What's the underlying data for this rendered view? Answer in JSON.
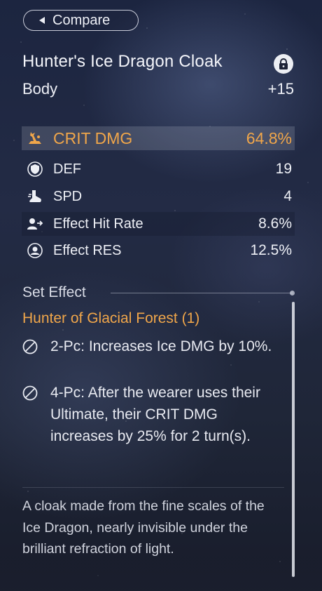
{
  "compare_button": {
    "label": "Compare",
    "icon": "back-triangle-icon"
  },
  "relic": {
    "name": "Hunter's Ice Dragon Cloak",
    "slot": "Body",
    "level": "+15",
    "lock_icon": "lock-icon"
  },
  "main_stat": {
    "name": "CRIT DMG",
    "value": "64.8%",
    "icon": "crit-dmg-icon",
    "color": "#f0a64a"
  },
  "sub_stats": [
    {
      "name": "DEF",
      "value": "19",
      "icon": "shield-icon"
    },
    {
      "name": "SPD",
      "value": "4",
      "icon": "boot-icon"
    },
    {
      "name": "Effect Hit Rate",
      "value": "8.6%",
      "icon": "effect-hit-rate-icon"
    },
    {
      "name": "Effect RES",
      "value": "12.5%",
      "icon": "effect-res-icon"
    }
  ],
  "set_effect": {
    "header": "Set Effect",
    "set_name": "Hunter of Glacial Forest (1)",
    "pieces": [
      {
        "text": "2-Pc: Increases Ice DMG by 10%.",
        "icon": "inactive-icon"
      },
      {
        "text": "4-Pc: After the wearer uses their Ultimate, their CRIT DMG increases by 25% for 2 turn(s).",
        "icon": "inactive-icon"
      }
    ]
  },
  "description": "A cloak made from the fine scales of the Ice Dragon, nearly invisible under the brilliant refraction of light."
}
